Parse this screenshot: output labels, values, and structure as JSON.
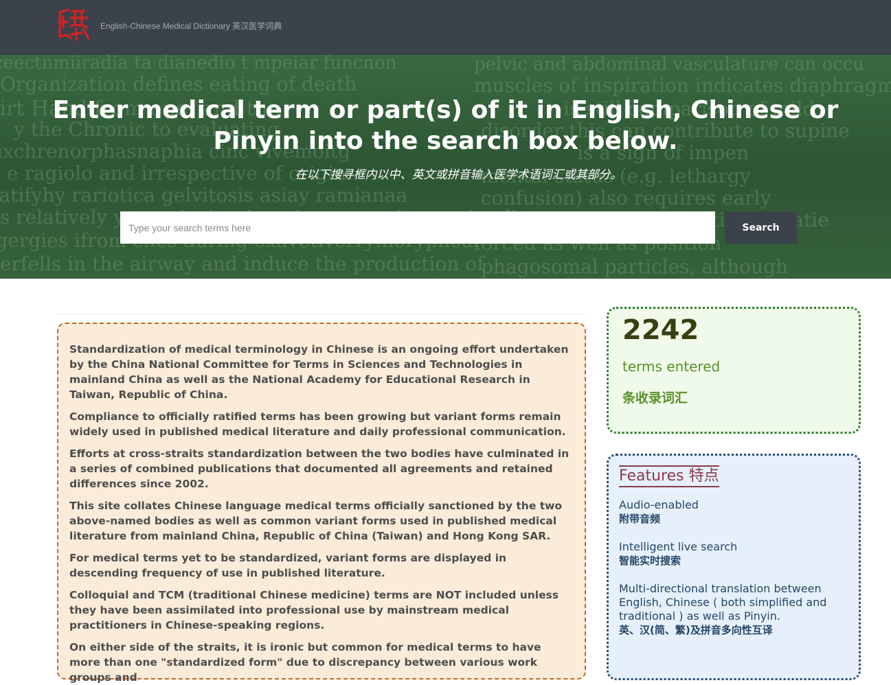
{
  "header": {
    "site_title": "English-Chinese Medical Dictionary 英汉医学词典",
    "logo_icon": "red-seal-logo-icon"
  },
  "hero": {
    "title": "Enter medical term or part(s) of it in English, Chinese or Pinyin into the search box below.",
    "subtitle": "在以下搜寻框内以中、英文或拼音输入医学术语词汇或其部分。",
    "search_placeholder": "Type your search terms here",
    "search_value": "",
    "search_button": "Search"
  },
  "about": {
    "paragraphs": [
      "Standardization of medical terminology in Chinese is an ongoing effort undertaken by the China National Committee for Terms in Sciences and Technologies in mainland China as well as the National Academy for Educational Research in Taiwan, Republic of China.",
      "Compliance to officially ratified terms has been growing but variant forms remain widely used in published medical literature and daily professional communication.",
      "Efforts at cross-straits standardization between the two bodies have culminated in a series of combined publications that documented all agreements and retained differences since 2002.",
      "This site collates Chinese language medical terms officially sanctioned by the two above-named bodies as well as common variant forms used in published medical literature from mainland China, Republic of China (Taiwan) and Hong Kong SAR.",
      "For medical terms yet to be standardized, variant forms are displayed in descending frequency of use in published literature.",
      "Colloquial and TCM (traditional Chinese medicine) terms are NOT included unless they have been assimilated into professional use by mainstream medical practitioners in Chinese-speaking regions.",
      "On either side of the straits, it is ironic but common for medical terms to have more than one \"standardized form\" due to discrepancy between various work groups and"
    ]
  },
  "stats": {
    "count": "2242",
    "label_en": "terms entered",
    "label_zh": "条收录词汇"
  },
  "features": {
    "heading": "Features 特点",
    "items": [
      {
        "en": "Audio-enabled",
        "zh": "附带音频"
      },
      {
        "en": "Intelligent live search",
        "zh": "智能实时搜索"
      },
      {
        "en": "Multi-directional translation between English, Chinese ( both simplified and traditional ) as well as Pinyin.",
        "zh": "英、汉(简、繁)及拼音多向性互译"
      }
    ]
  },
  "colors": {
    "navbar": "#3b424b",
    "hero_green": "#2f5a35",
    "about_bg": "#faecd9",
    "about_border": "#bf6a1f",
    "stats_bg": "#effaea",
    "stats_border": "#2f7d2f",
    "features_bg": "#e6f0fb",
    "features_heading": "#8a3b4a",
    "logo_red": "#d42222"
  }
}
